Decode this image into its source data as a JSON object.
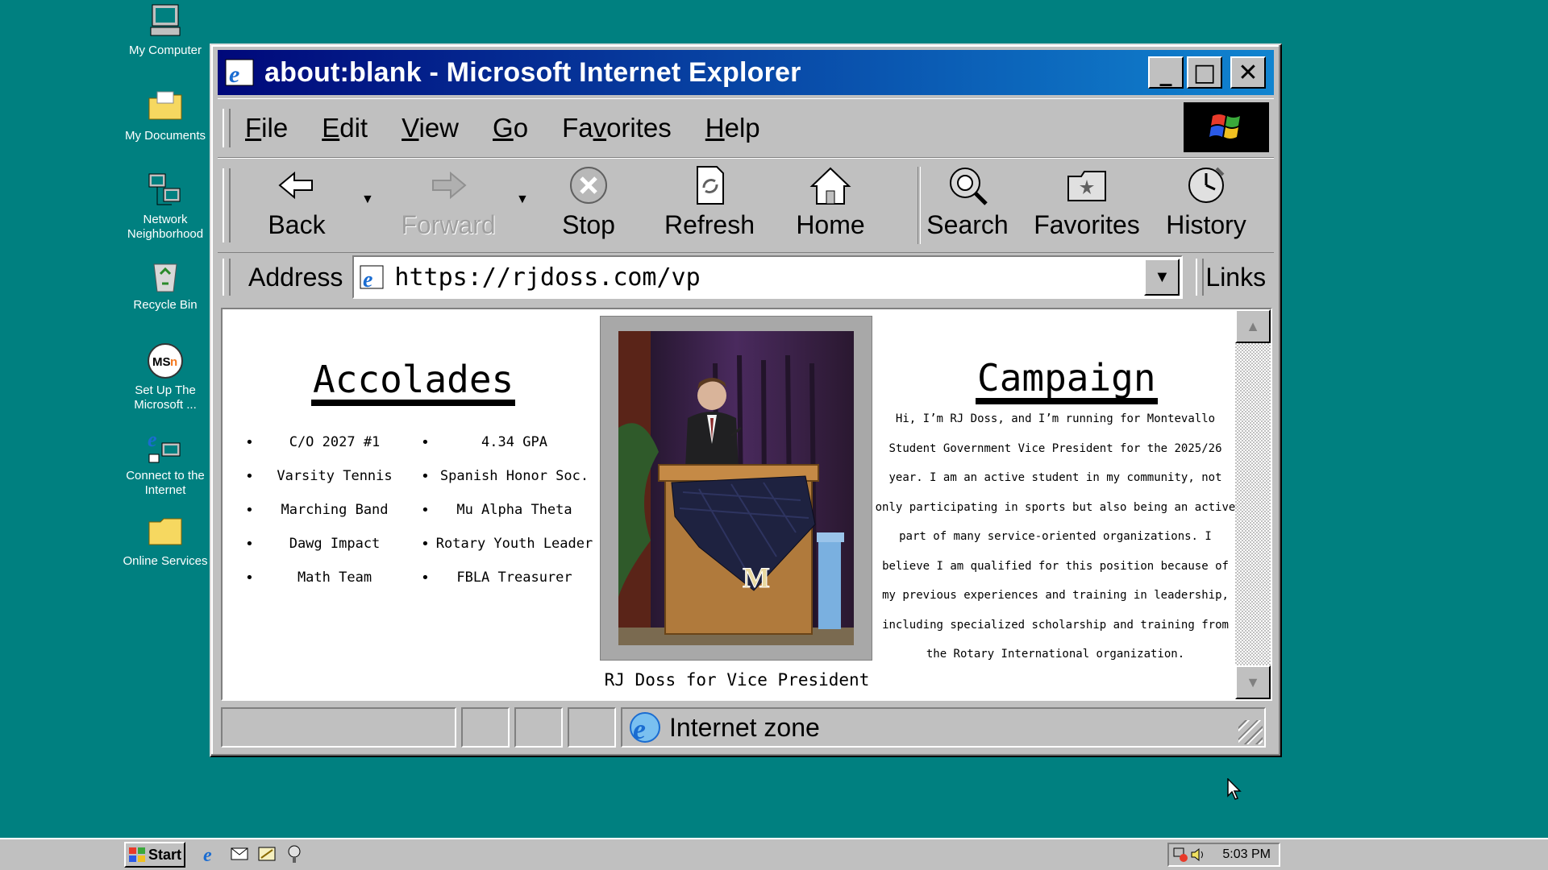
{
  "desktop": {
    "icons": [
      {
        "label": "My Computer"
      },
      {
        "label": "My Documents"
      },
      {
        "label": "Network Neighborhood"
      },
      {
        "label": "Recycle Bin"
      },
      {
        "label": "Set Up The Microsoft ..."
      },
      {
        "label": "Connect to the Internet"
      },
      {
        "label": "Online Services"
      }
    ]
  },
  "window": {
    "title": "about:blank - Microsoft Internet Explorer",
    "controls": {
      "minimize": "_",
      "maximize": "□",
      "close": "✕"
    },
    "menu": [
      {
        "key": "F",
        "rest": "ile"
      },
      {
        "key": "E",
        "rest": "dit"
      },
      {
        "key": "V",
        "rest": "iew"
      },
      {
        "key": "G",
        "rest": "o"
      },
      {
        "pre": "Fa",
        "key": "v",
        "rest": "orites"
      },
      {
        "key": "H",
        "rest": "elp"
      }
    ],
    "toolbar": {
      "back": "Back",
      "forward": "Forward",
      "stop": "Stop",
      "refresh": "Refresh",
      "home": "Home",
      "search": "Search",
      "favorites": "Favorites",
      "history": "History"
    },
    "address": {
      "label": "Address",
      "url": "https://rjdoss.com/vp",
      "links_label": "Links"
    },
    "status": {
      "zone": "Internet zone"
    }
  },
  "page": {
    "accolades": {
      "title": "Accolades",
      "left": [
        "C/O 2027 #1",
        "Varsity Tennis",
        "Marching Band",
        "Dawg Impact",
        "Math Team"
      ],
      "right": [
        "4.34 GPA",
        "Spanish Honor Soc.",
        "Mu Alpha Theta",
        "Rotary Youth Leader",
        "FBLA Treasurer"
      ]
    },
    "photo": {
      "caption": "RJ Doss for Vice President",
      "podium_letter": "M"
    },
    "campaign": {
      "title": "Campaign",
      "lines": [
        "Hi, I’m RJ Doss, and I’m running for Montevallo",
        "Student Government Vice President for the 2025/26",
        "year. I am an active student in my community, not",
        "only participating in sports but also being an active",
        "part of many service-oriented organizations. I",
        "believe I am qualified for this position because of",
        "my previous experiences and training in leadership,",
        "including specialized scholarship and training from",
        "the Rotary International organization."
      ]
    }
  },
  "taskbar": {
    "start": "Start",
    "clock": "5:03 PM"
  },
  "colors": {
    "desktop": "#008080",
    "title_gradient_start": "#00087a",
    "title_gradient_end": "#1084d0",
    "chrome": "#c0c0c0"
  }
}
